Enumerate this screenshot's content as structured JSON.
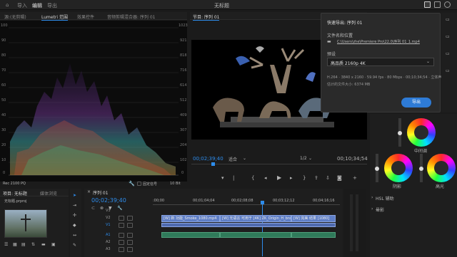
{
  "topbar": {
    "tabs": [
      "导入",
      "编辑",
      "导出"
    ],
    "title": "无标题"
  },
  "scope_panel": {
    "tabs": [
      "源:(无剪辑)",
      "Lumetri 范围",
      "效果控件",
      "音频剪辑混合器: 序列 01"
    ],
    "left_scale": [
      "100",
      "90",
      "80",
      "70",
      "60",
      "50",
      "40",
      "30",
      "20",
      "10",
      "0"
    ],
    "right_scale": [
      "1023",
      "921",
      "818",
      "716",
      "614",
      "512",
      "409",
      "307",
      "204",
      "102",
      "0"
    ],
    "footer_left": "Rec 2100 PQ",
    "footer_check": "固定信号",
    "footer_bits": "10 Bit"
  },
  "program_monitor": {
    "title": "节目: 序列 01",
    "timecode": "00;02;39;40",
    "fit": "适合",
    "ratio": "1/2",
    "duration": "00;10;34;54"
  },
  "quick_export": {
    "title": "快速导出: 序列 01",
    "file_label": "文件名和位置",
    "file_path": "C:\\Users\\zhe\\Premiere Pro\\22.0\\序列 01_1.mp4",
    "preset_label": "预设",
    "preset_value": "高品质 2160p 4K",
    "info_line1": "H.264 · 3840 x 2160 · 59.94 fps · 80 Mbps · 00;10;34;54 · 立体声",
    "info_line2": "估计的文件大小: 6374 MB",
    "export_button": "导出"
  },
  "right_panel": {
    "labels": [
      "中间调",
      "阴影",
      "高光",
      "HSL 辅助",
      "晕影"
    ]
  },
  "project_panel": {
    "tabs": [
      "项目: 无标题",
      "媒体浏览"
    ],
    "item": "无标题.prproj"
  },
  "timeline": {
    "tab": "序列 01",
    "timecode": "00;02;39;40",
    "ruler": [
      ":00;00",
      "00;01;04;04",
      "00;02;08;08",
      "00;03;12;12",
      "00;04;16;16"
    ],
    "video_tracks": [
      "V3",
      "V2",
      "V1"
    ],
    "audio_tracks": [
      "A1",
      "A2",
      "A3"
    ],
    "clips": [
      "[W] 新 功能_Smoke_1080.mp4",
      "[W] 无语言 可用于 [4K] ZK_Origin_H_bra",
      "[W] 完美 结果 [1080]"
    ]
  },
  "colors": {
    "accent": "#2d8ceb",
    "clip": "#5f7fc7",
    "audio_clip": "#2f7a5a"
  }
}
